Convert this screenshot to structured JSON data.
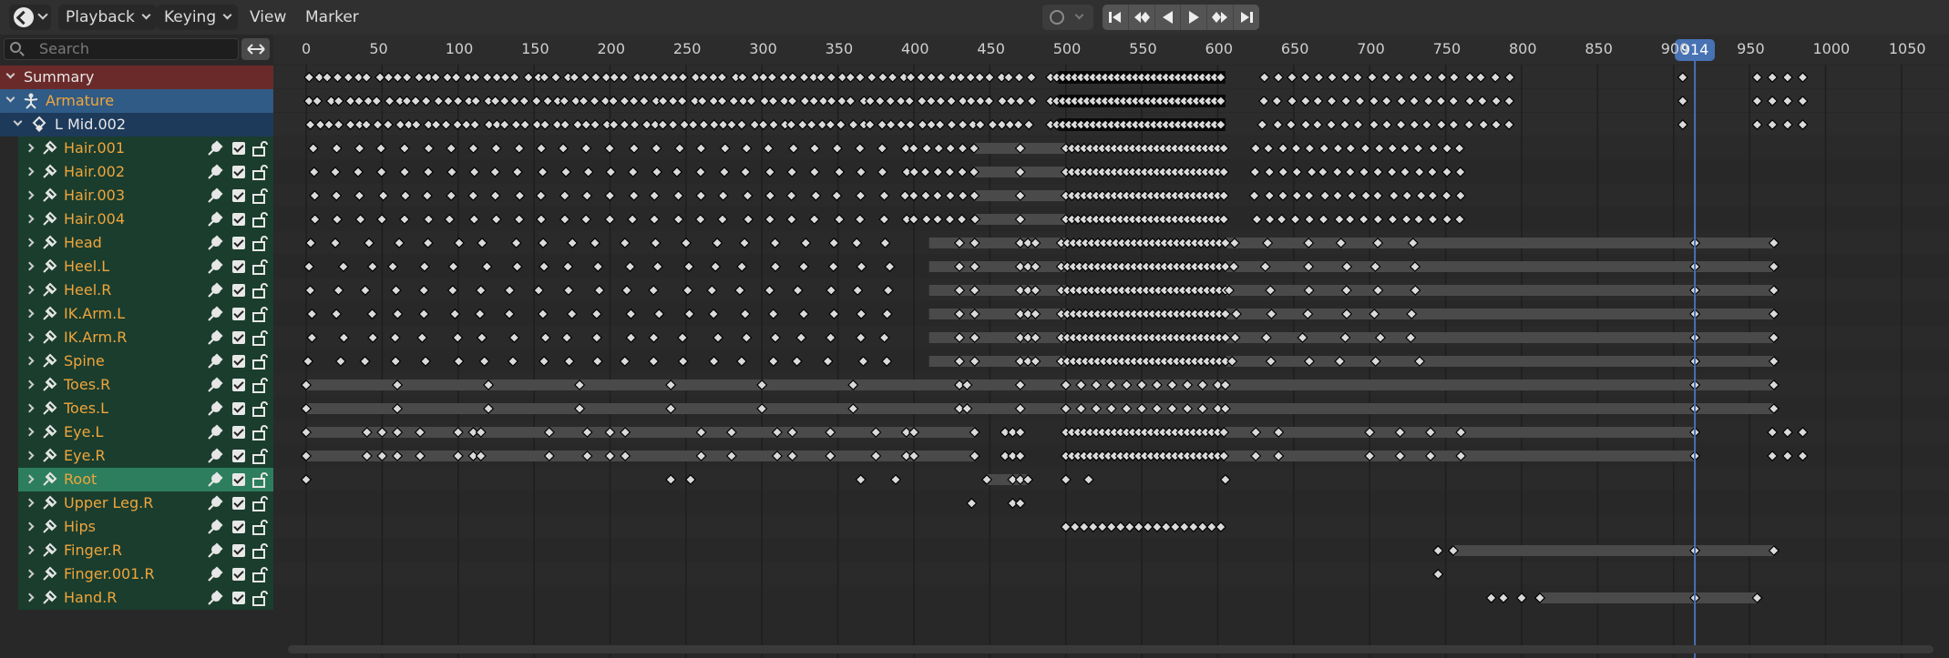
{
  "header": {
    "menus": [
      "Playback",
      "Keying",
      "View",
      "Marker"
    ]
  },
  "search": {
    "placeholder": "Search"
  },
  "channels": {
    "summary": "Summary",
    "armature": "Armature",
    "action": "L Mid.002",
    "bones": [
      {
        "name": "Hair.001",
        "selected": false
      },
      {
        "name": "Hair.002",
        "selected": false
      },
      {
        "name": "Hair.003",
        "selected": false
      },
      {
        "name": "Hair.004",
        "selected": false
      },
      {
        "name": "Head",
        "selected": false
      },
      {
        "name": "Heel.L",
        "selected": false
      },
      {
        "name": "Heel.R",
        "selected": false
      },
      {
        "name": "IK.Arm.L",
        "selected": false
      },
      {
        "name": "IK.Arm.R",
        "selected": false
      },
      {
        "name": "Spine",
        "selected": false
      },
      {
        "name": "Toes.R",
        "selected": false
      },
      {
        "name": "Toes.L",
        "selected": false
      },
      {
        "name": "Eye.L",
        "selected": false
      },
      {
        "name": "Eye.R",
        "selected": false
      },
      {
        "name": "Root",
        "selected": true
      },
      {
        "name": "Upper Leg.R",
        "selected": false
      },
      {
        "name": "Hips",
        "selected": false
      },
      {
        "name": "Finger.R",
        "selected": false
      },
      {
        "name": "Finger.001.R",
        "selected": false
      },
      {
        "name": "Hand.R",
        "selected": false
      }
    ]
  },
  "timeline": {
    "ruler_labels": [
      "0",
      "50",
      "100",
      "150",
      "200",
      "250",
      "300",
      "350",
      "400",
      "450",
      "500",
      "550",
      "600",
      "650",
      "700",
      "750",
      "800",
      "850",
      "900",
      "950",
      "1000",
      "1050"
    ],
    "current_frame": "914",
    "frame_min": 0,
    "frame_max": 1050
  },
  "colors": {
    "accent": "#4772b3",
    "summary_bg": "#6b2a2a",
    "armature_bg": "#2f5b86",
    "bone_bg": "#1a3d2e",
    "bone_selected_bg": "#2c7e5e",
    "bone_text": "#f0a53b"
  }
}
